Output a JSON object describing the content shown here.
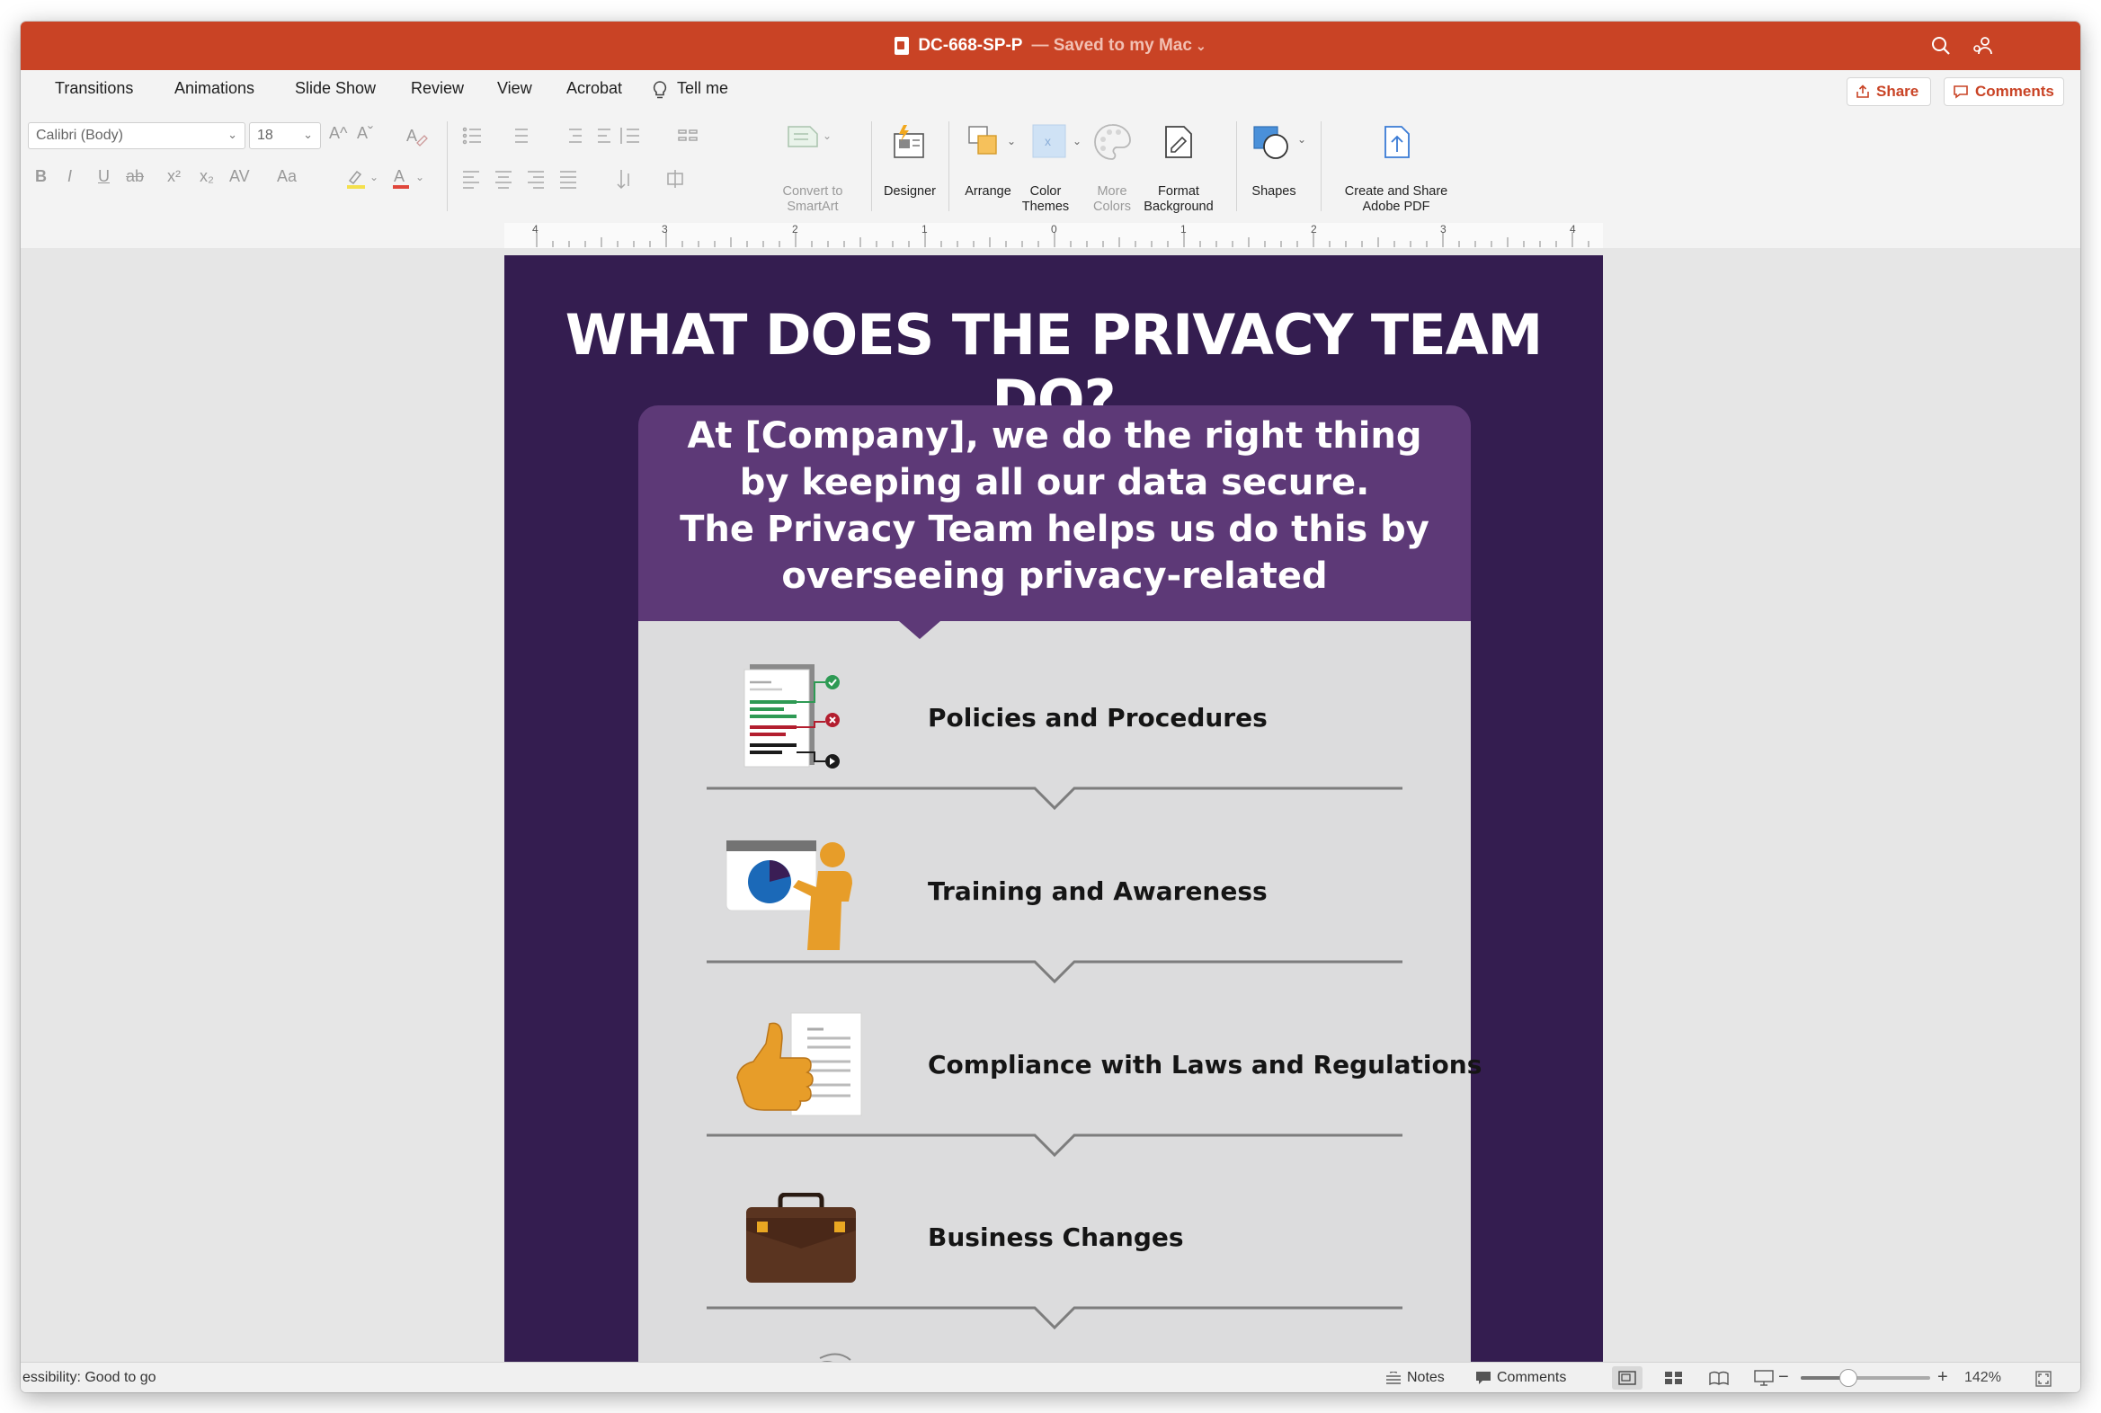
{
  "window": {
    "doc_title": "DC-668-SP-P",
    "save_status": "— Saved to my Mac",
    "save_chevron": "⌄"
  },
  "tabs": [
    "Transitions",
    "Animations",
    "Slide Show",
    "Review",
    "View",
    "Acrobat"
  ],
  "tell_me": "Tell me",
  "top_buttons": {
    "share": "Share",
    "comments": "Comments"
  },
  "ribbon": {
    "font_name": "Calibri (Body)",
    "font_size": "18",
    "grow_font": "A^",
    "shrink_font": "Aˇ",
    "format_buttons": {
      "bold": "B",
      "italic": "I",
      "underline": "U",
      "strike": "ab",
      "superscript": "x²",
      "subscript": "x₂",
      "spacing": "AV",
      "change_case": "Aa"
    },
    "convert_smartart": [
      "Convert to",
      "SmartArt"
    ],
    "designer": "Designer",
    "arrange": "Arrange",
    "color_themes": [
      "Color",
      "Themes"
    ],
    "more_colors": [
      "More",
      "Colors"
    ],
    "format_background": [
      "Format",
      "Background"
    ],
    "shapes": "Shapes",
    "adobe_pdf": [
      "Create and Share",
      "Adobe PDF"
    ]
  },
  "ruler_labels": [
    "4",
    "3",
    "2",
    "1",
    "0",
    "1",
    "2",
    "3",
    "4"
  ],
  "slide": {
    "title": "WHAT DOES THE PRIVACY TEAM DO?",
    "intro_lines": [
      "At [Company], we do the right thing",
      "by keeping all our data secure.",
      "The Privacy Team helps us do this by",
      "overseeing privacy-related"
    ],
    "items": [
      {
        "label": "Policies and Procedures",
        "icon": "policy-document-icon"
      },
      {
        "label": "Training and Awareness",
        "icon": "presenter-chart-icon"
      },
      {
        "label": "Compliance with Laws and Regulations",
        "icon": "thumbs-up-document-icon"
      },
      {
        "label": "Business Changes",
        "icon": "briefcase-icon"
      }
    ]
  },
  "statusbar": {
    "accessibility": "essibility: Good to go",
    "notes": "Notes",
    "comments": "Comments",
    "zoom_minus": "−",
    "zoom_plus": "+",
    "zoom_level": "142%",
    "zoom_fraction": 0.37
  },
  "colors": {
    "titlebar": "#c94325",
    "slide_background": "#341d50",
    "intro_box": "#5d3977",
    "content_panel": "#dcdcdd",
    "accent_orange": "#e79d29"
  }
}
